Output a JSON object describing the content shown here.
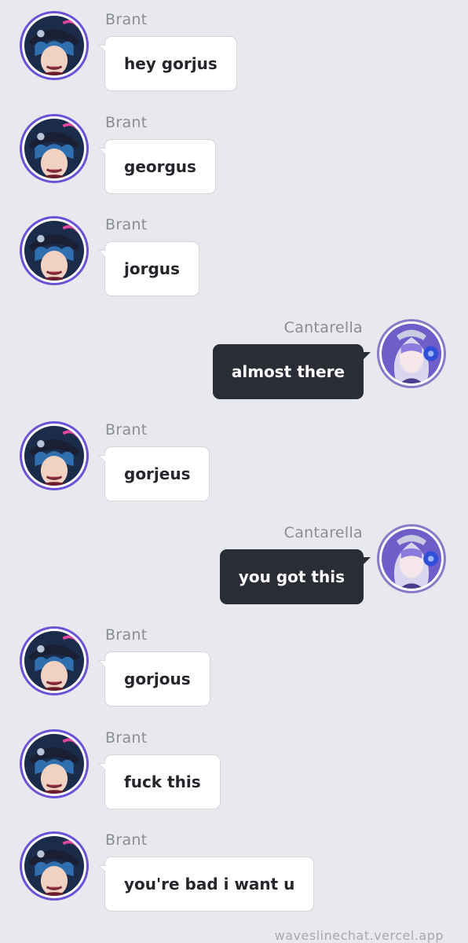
{
  "messages": [
    {
      "side": "left",
      "sender": "Brant",
      "text": "hey gorjus"
    },
    {
      "side": "left",
      "sender": "Brant",
      "text": "georgus"
    },
    {
      "side": "left",
      "sender": "Brant",
      "text": "jorgus"
    },
    {
      "side": "right",
      "sender": "Cantarella",
      "text": "almost there"
    },
    {
      "side": "left",
      "sender": "Brant",
      "text": "gorjeus"
    },
    {
      "side": "right",
      "sender": "Cantarella",
      "text": "you got this"
    },
    {
      "side": "left",
      "sender": "Brant",
      "text": "gorjous"
    },
    {
      "side": "left",
      "sender": "Brant",
      "text": "fuck this"
    },
    {
      "side": "left",
      "sender": "Brant",
      "text": "you're bad i want u"
    }
  ],
  "watermark": "waveslinechat.vercel.app",
  "colors": {
    "background": "#e8e9ee",
    "incoming_bubble": "#ffffff",
    "outgoing_bubble": "#2a2d36",
    "sender_name": "#8b8d94",
    "brant_avatar_ring": "#6a52d8",
    "cantarella_avatar_ring": "#8b78c6"
  },
  "icons": {
    "left_avatar": "brant-avatar-icon",
    "right_avatar": "cantarella-avatar-icon"
  }
}
